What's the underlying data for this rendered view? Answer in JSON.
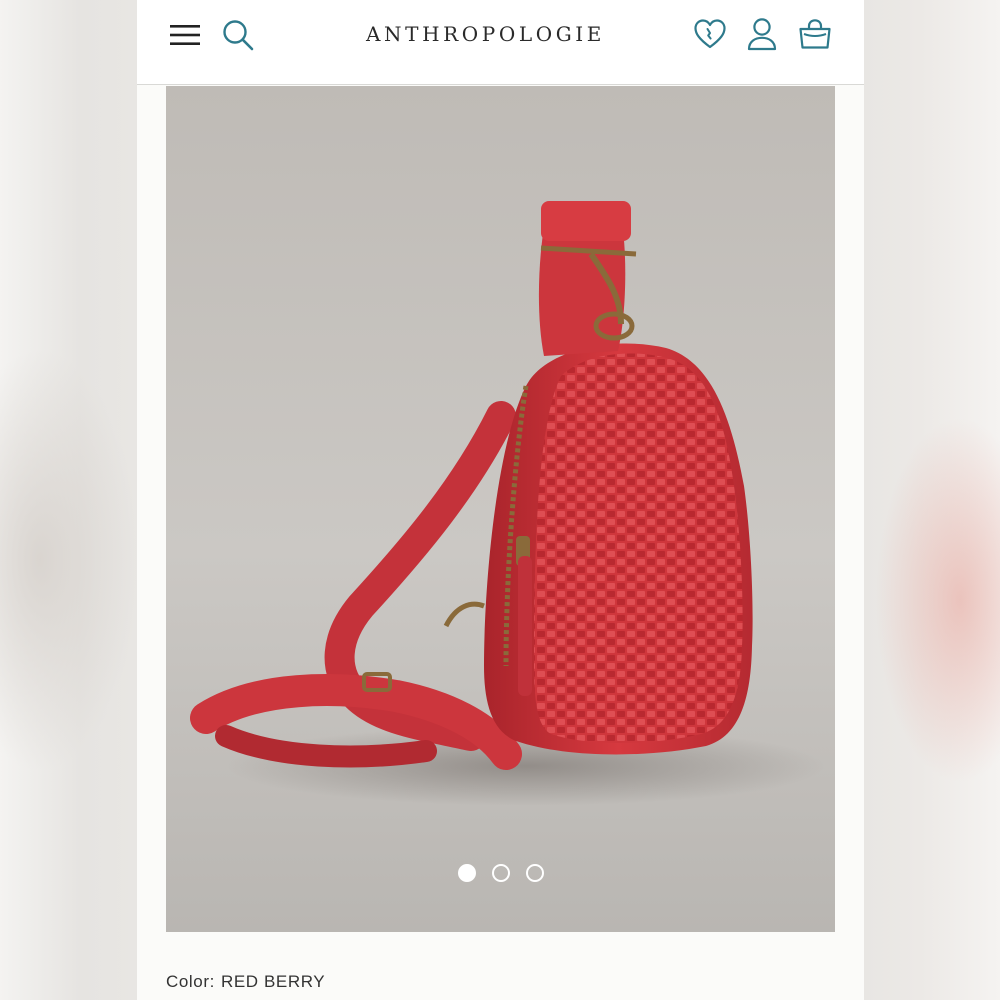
{
  "header": {
    "logo": "ANTHROPOLOGIE",
    "icons": {
      "menu": "hamburger-menu-icon",
      "search": "search-icon",
      "wishlist": "heart-icon",
      "account": "user-icon",
      "bag": "shopping-bag-icon"
    }
  },
  "colors": {
    "accent": "#2e7a8c",
    "product": "#d23a3f",
    "hardware": "#8a6a3a",
    "text": "#333333"
  },
  "gallery": {
    "slide_count": 3,
    "active_slide": 1
  },
  "product": {
    "color_label": "Color:",
    "color_value": "RED BERRY"
  }
}
